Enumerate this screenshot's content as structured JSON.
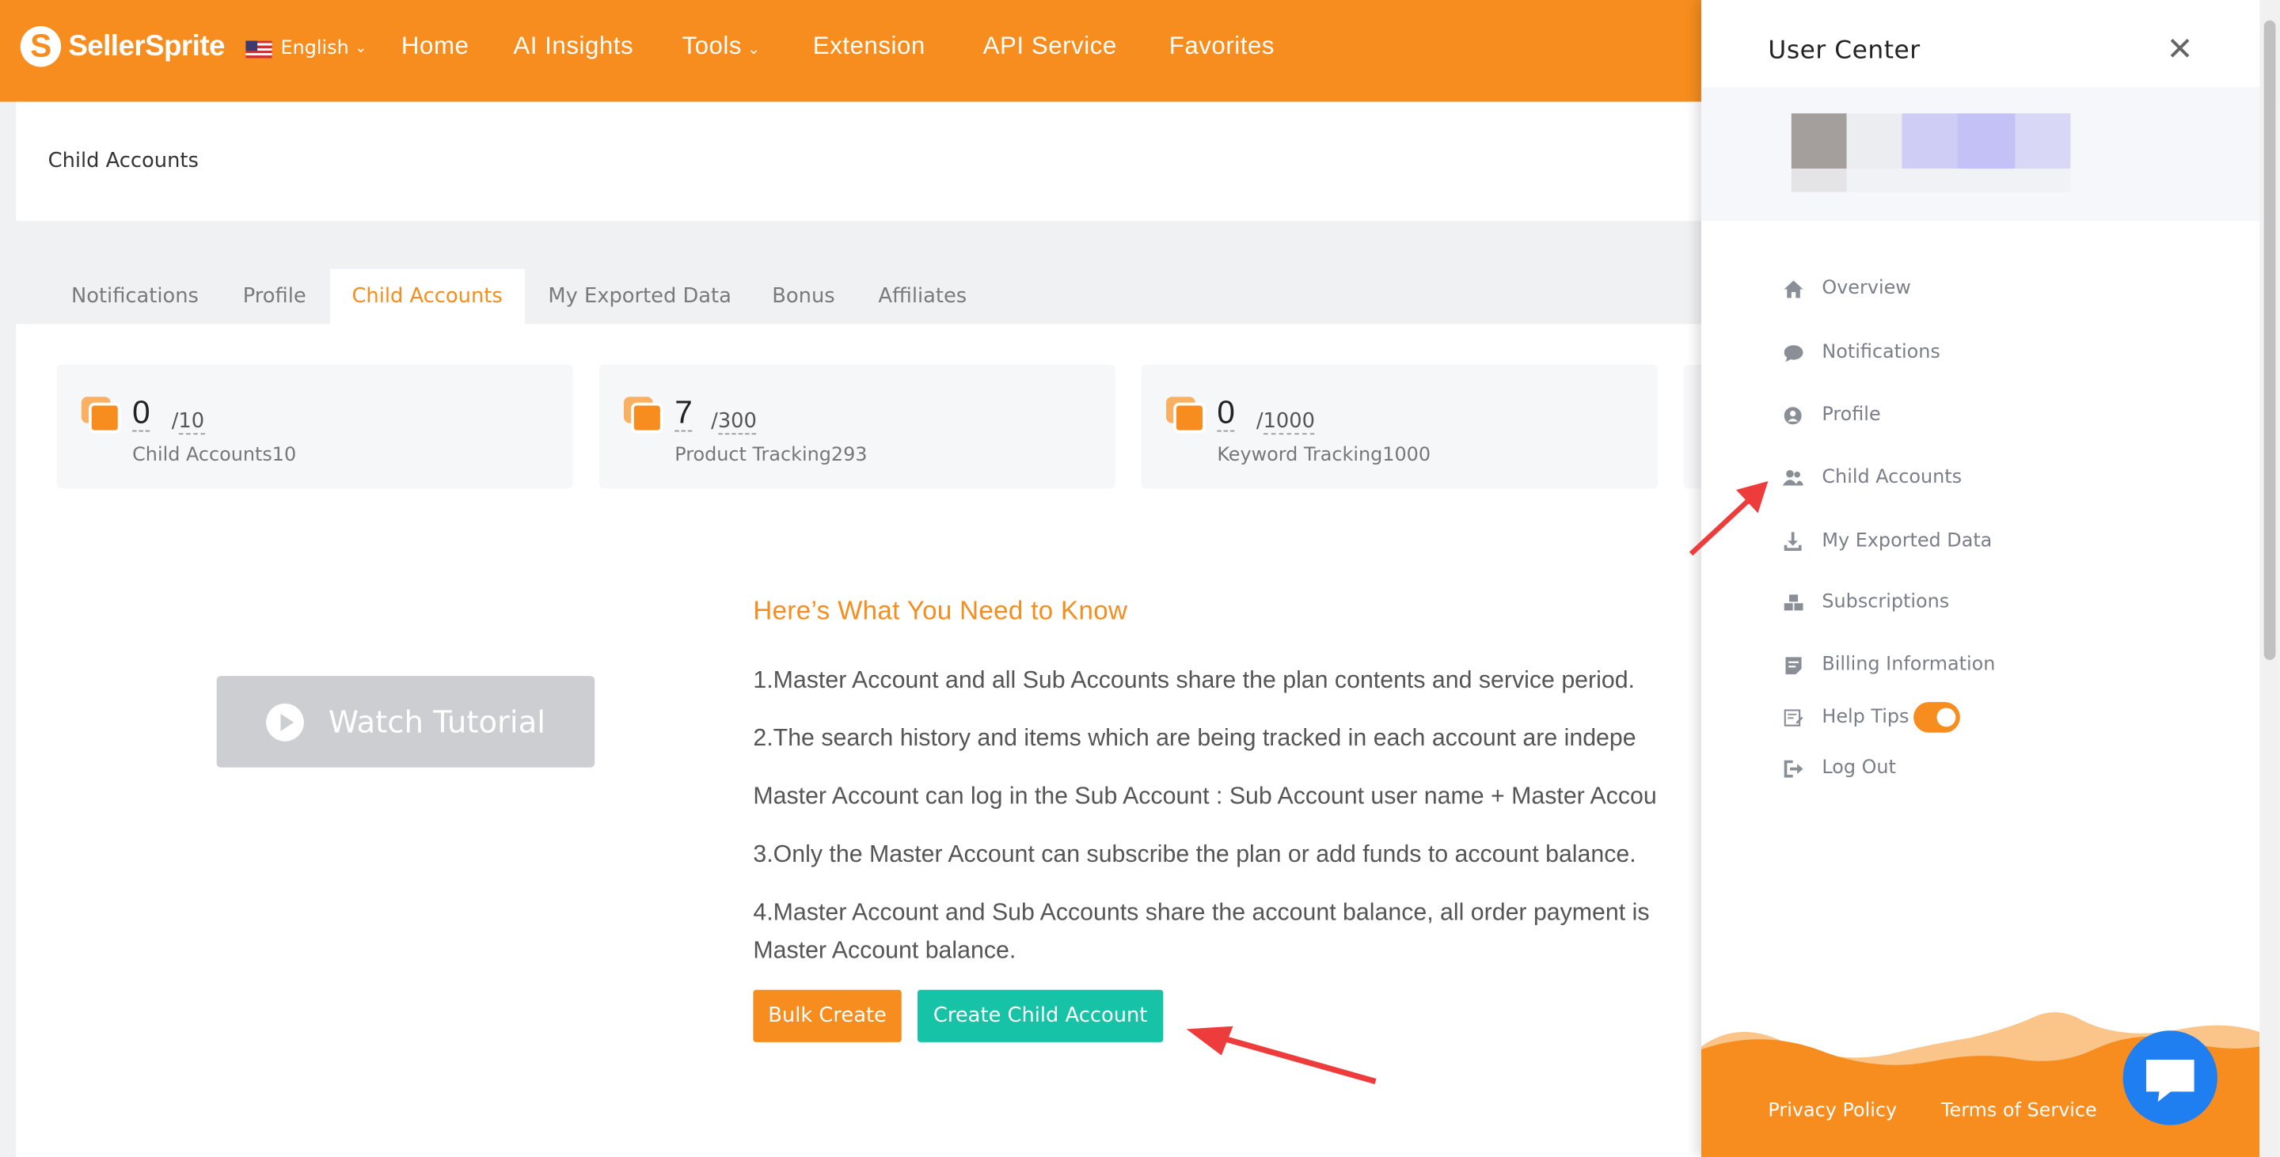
{
  "header": {
    "brand": "SellerSprite",
    "logo_letter": "S",
    "language": "English",
    "nav": [
      "Home",
      "AI Insights",
      "Tools",
      "Extension",
      "API Service",
      "Favorites"
    ],
    "brand_color": "#f68d1e"
  },
  "page": {
    "title": "Child Accounts"
  },
  "tabs": [
    {
      "label": "Notifications",
      "active": false
    },
    {
      "label": "Profile",
      "active": false
    },
    {
      "label": "Child Accounts",
      "active": true
    },
    {
      "label": "My Exported Data",
      "active": false
    },
    {
      "label": "Bonus",
      "active": false
    },
    {
      "label": "Affiliates",
      "active": false
    }
  ],
  "stats": [
    {
      "used": "0",
      "total": "10",
      "label": "Child Accounts10"
    },
    {
      "used": "7",
      "total": "300",
      "label": "Product Tracking293"
    },
    {
      "used": "0",
      "total": "1000",
      "label": "Keyword Tracking1000"
    }
  ],
  "tutorial": {
    "label": "Watch Tutorial"
  },
  "know": {
    "title": "Here’s What You Need to Know",
    "lines": [
      "1.Master Account and all Sub Accounts share the plan contents and service period.",
      "2.The search history and items which are being tracked in each account are indepe",
      "Master Account can log in the Sub Account : Sub Account user name + Master Accou",
      "3.Only the Master Account can subscribe the plan or add funds to account balance.",
      "4.Master Account and Sub Accounts share the account balance, all order payment is",
      "Master Account balance."
    ]
  },
  "actions": {
    "bulk_create": "Bulk Create",
    "create_child": "Create Child Account",
    "bulk_color": "#f68d1e",
    "create_color": "#17c3a6"
  },
  "user_center": {
    "title": "User Center",
    "menu": [
      {
        "label": "Overview",
        "icon": "home-icon"
      },
      {
        "label": "Notifications",
        "icon": "chat-bubble-icon"
      },
      {
        "label": "Profile",
        "icon": "user-circle-icon"
      },
      {
        "label": "Child Accounts",
        "icon": "users-icon"
      },
      {
        "label": "My Exported Data",
        "icon": "download-icon"
      },
      {
        "label": "Subscriptions",
        "icon": "cubes-icon"
      },
      {
        "label": "Billing Information",
        "icon": "billing-icon"
      },
      {
        "label": "Help Tips",
        "icon": "help-tips-icon"
      },
      {
        "label": "Log Out",
        "icon": "logout-icon"
      }
    ],
    "help_tips_enabled": true,
    "footer": {
      "privacy": "Privacy Policy",
      "terms": "Terms of Service"
    }
  }
}
